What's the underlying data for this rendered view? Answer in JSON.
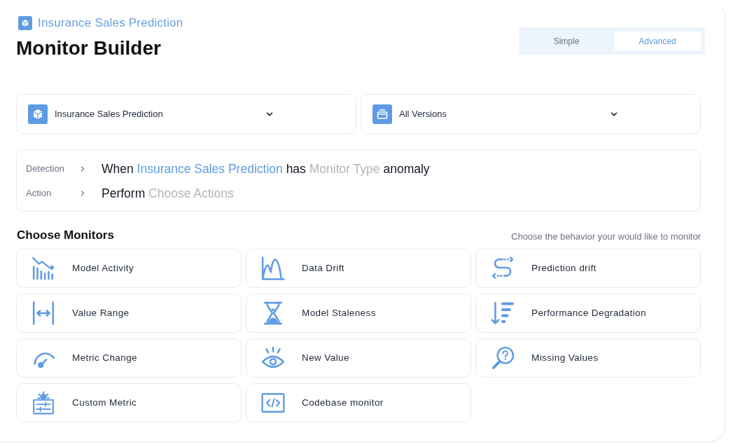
{
  "breadcrumb": {
    "label": "Insurance Sales Prediction"
  },
  "title": "Monitor Builder",
  "mode_tabs": [
    {
      "label": "Simple",
      "selected": false
    },
    {
      "label": "Advanced",
      "selected": true
    }
  ],
  "selectors": [
    {
      "value": "Insurance Sales Prediction"
    },
    {
      "value": "All Versions"
    }
  ],
  "rule": [
    {
      "label": "Detection",
      "parts": [
        {
          "text": "When",
          "kind": "text"
        },
        {
          "text": "Insurance Sales Prediction",
          "kind": "value"
        },
        {
          "text": "has",
          "kind": "text"
        },
        {
          "text": "Monitor Type",
          "kind": "placeholder"
        },
        {
          "text": "anomaly",
          "kind": "text"
        }
      ]
    },
    {
      "label": "Action",
      "parts": [
        {
          "text": "Perform",
          "kind": "text"
        },
        {
          "text": "Choose Actions",
          "kind": "placeholder"
        }
      ]
    }
  ],
  "monitors": {
    "title": "Choose Monitors",
    "hint": "Choose the behavior your would like to monitor",
    "items": [
      {
        "label": "Model Activity",
        "selected": false
      },
      {
        "label": "Data Drift",
        "selected": false
      },
      {
        "label": "Prediction drift",
        "selected": false
      },
      {
        "label": "Value Range",
        "selected": false
      },
      {
        "label": "Model Staleness",
        "selected": false
      },
      {
        "label": "Performance Degradation",
        "selected": false
      },
      {
        "label": "Metric Change",
        "selected": false
      },
      {
        "label": "New Value",
        "selected": false
      },
      {
        "label": "Missing Values",
        "selected": false
      },
      {
        "label": "Custom Metric",
        "selected": false
      },
      {
        "label": "Codebase monitor",
        "selected": false
      }
    ]
  }
}
